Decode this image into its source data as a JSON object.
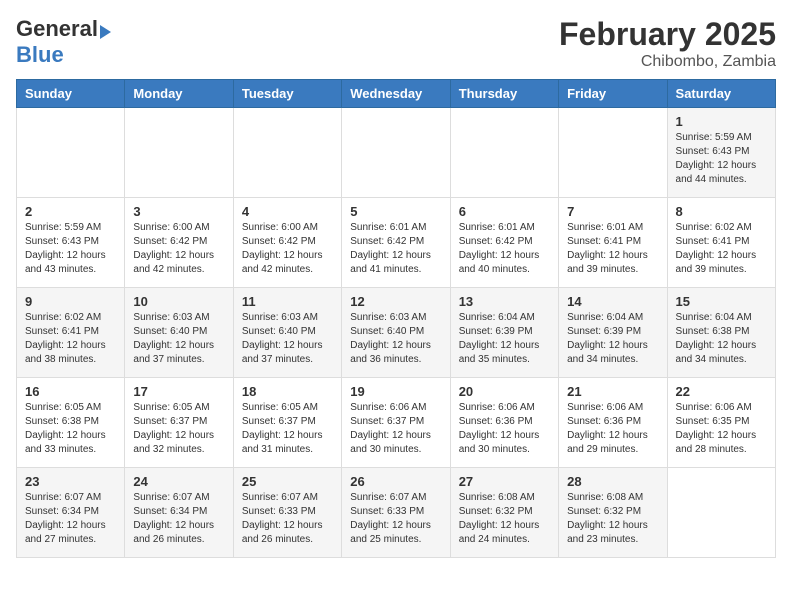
{
  "header": {
    "logo_general": "General",
    "logo_blue": "Blue",
    "title": "February 2025",
    "subtitle": "Chibombo, Zambia"
  },
  "days_of_week": [
    "Sunday",
    "Monday",
    "Tuesday",
    "Wednesday",
    "Thursday",
    "Friday",
    "Saturday"
  ],
  "weeks": [
    [
      {
        "day": "",
        "info": ""
      },
      {
        "day": "",
        "info": ""
      },
      {
        "day": "",
        "info": ""
      },
      {
        "day": "",
        "info": ""
      },
      {
        "day": "",
        "info": ""
      },
      {
        "day": "",
        "info": ""
      },
      {
        "day": "1",
        "info": "Sunrise: 5:59 AM\nSunset: 6:43 PM\nDaylight: 12 hours\nand 44 minutes."
      }
    ],
    [
      {
        "day": "2",
        "info": "Sunrise: 5:59 AM\nSunset: 6:43 PM\nDaylight: 12 hours\nand 43 minutes."
      },
      {
        "day": "3",
        "info": "Sunrise: 6:00 AM\nSunset: 6:42 PM\nDaylight: 12 hours\nand 42 minutes."
      },
      {
        "day": "4",
        "info": "Sunrise: 6:00 AM\nSunset: 6:42 PM\nDaylight: 12 hours\nand 42 minutes."
      },
      {
        "day": "5",
        "info": "Sunrise: 6:01 AM\nSunset: 6:42 PM\nDaylight: 12 hours\nand 41 minutes."
      },
      {
        "day": "6",
        "info": "Sunrise: 6:01 AM\nSunset: 6:42 PM\nDaylight: 12 hours\nand 40 minutes."
      },
      {
        "day": "7",
        "info": "Sunrise: 6:01 AM\nSunset: 6:41 PM\nDaylight: 12 hours\nand 39 minutes."
      },
      {
        "day": "8",
        "info": "Sunrise: 6:02 AM\nSunset: 6:41 PM\nDaylight: 12 hours\nand 39 minutes."
      }
    ],
    [
      {
        "day": "9",
        "info": "Sunrise: 6:02 AM\nSunset: 6:41 PM\nDaylight: 12 hours\nand 38 minutes."
      },
      {
        "day": "10",
        "info": "Sunrise: 6:03 AM\nSunset: 6:40 PM\nDaylight: 12 hours\nand 37 minutes."
      },
      {
        "day": "11",
        "info": "Sunrise: 6:03 AM\nSunset: 6:40 PM\nDaylight: 12 hours\nand 37 minutes."
      },
      {
        "day": "12",
        "info": "Sunrise: 6:03 AM\nSunset: 6:40 PM\nDaylight: 12 hours\nand 36 minutes."
      },
      {
        "day": "13",
        "info": "Sunrise: 6:04 AM\nSunset: 6:39 PM\nDaylight: 12 hours\nand 35 minutes."
      },
      {
        "day": "14",
        "info": "Sunrise: 6:04 AM\nSunset: 6:39 PM\nDaylight: 12 hours\nand 34 minutes."
      },
      {
        "day": "15",
        "info": "Sunrise: 6:04 AM\nSunset: 6:38 PM\nDaylight: 12 hours\nand 34 minutes."
      }
    ],
    [
      {
        "day": "16",
        "info": "Sunrise: 6:05 AM\nSunset: 6:38 PM\nDaylight: 12 hours\nand 33 minutes."
      },
      {
        "day": "17",
        "info": "Sunrise: 6:05 AM\nSunset: 6:37 PM\nDaylight: 12 hours\nand 32 minutes."
      },
      {
        "day": "18",
        "info": "Sunrise: 6:05 AM\nSunset: 6:37 PM\nDaylight: 12 hours\nand 31 minutes."
      },
      {
        "day": "19",
        "info": "Sunrise: 6:06 AM\nSunset: 6:37 PM\nDaylight: 12 hours\nand 30 minutes."
      },
      {
        "day": "20",
        "info": "Sunrise: 6:06 AM\nSunset: 6:36 PM\nDaylight: 12 hours\nand 30 minutes."
      },
      {
        "day": "21",
        "info": "Sunrise: 6:06 AM\nSunset: 6:36 PM\nDaylight: 12 hours\nand 29 minutes."
      },
      {
        "day": "22",
        "info": "Sunrise: 6:06 AM\nSunset: 6:35 PM\nDaylight: 12 hours\nand 28 minutes."
      }
    ],
    [
      {
        "day": "23",
        "info": "Sunrise: 6:07 AM\nSunset: 6:34 PM\nDaylight: 12 hours\nand 27 minutes."
      },
      {
        "day": "24",
        "info": "Sunrise: 6:07 AM\nSunset: 6:34 PM\nDaylight: 12 hours\nand 26 minutes."
      },
      {
        "day": "25",
        "info": "Sunrise: 6:07 AM\nSunset: 6:33 PM\nDaylight: 12 hours\nand 26 minutes."
      },
      {
        "day": "26",
        "info": "Sunrise: 6:07 AM\nSunset: 6:33 PM\nDaylight: 12 hours\nand 25 minutes."
      },
      {
        "day": "27",
        "info": "Sunrise: 6:08 AM\nSunset: 6:32 PM\nDaylight: 12 hours\nand 24 minutes."
      },
      {
        "day": "28",
        "info": "Sunrise: 6:08 AM\nSunset: 6:32 PM\nDaylight: 12 hours\nand 23 minutes."
      },
      {
        "day": "",
        "info": ""
      }
    ]
  ]
}
